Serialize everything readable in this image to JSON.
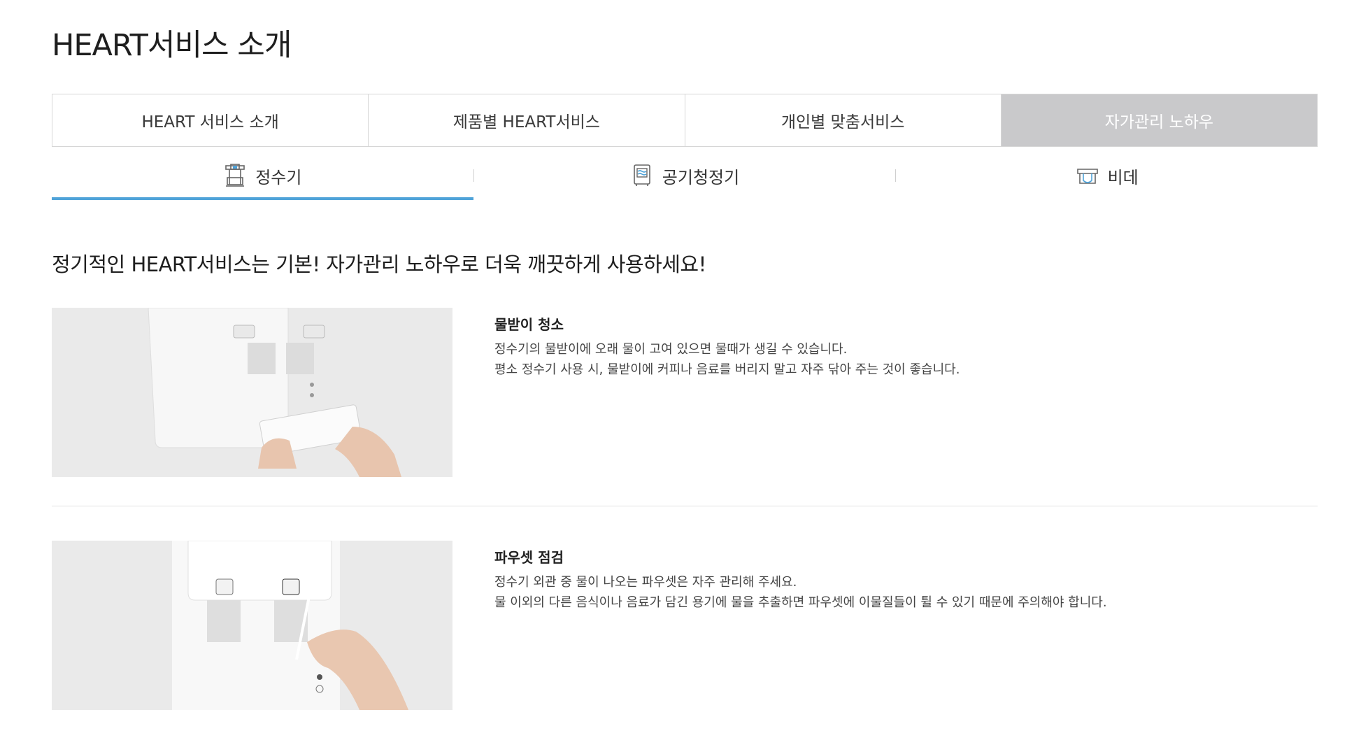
{
  "page": {
    "title": "HEART서비스 소개"
  },
  "main_tabs": [
    {
      "label": "HEART 서비스 소개",
      "active": false
    },
    {
      "label": "제품별 HEART서비스",
      "active": false
    },
    {
      "label": "개인별 맞춤서비스",
      "active": false
    },
    {
      "label": "자가관리 노하우",
      "active": true
    }
  ],
  "sub_tabs": [
    {
      "label": "정수기",
      "icon": "water-purifier-icon",
      "active": true
    },
    {
      "label": "공기청정기",
      "icon": "air-purifier-icon",
      "active": false
    },
    {
      "label": "비데",
      "icon": "bidet-icon",
      "active": false
    }
  ],
  "intro": "정기적인 HEART서비스는 기본! 자가관리 노하우로 더욱 깨끗하게 사용하세요!",
  "tips": [
    {
      "title": "물받이 청소",
      "lines": [
        "정수기의 물받이에 오래 물이 고여 있으면 물때가 생길 수 있습니다.",
        "평소 정수기 사용 시, 물받이에 커피나 음료를 버리지 말고 자주 닦아 주는 것이 좋습니다."
      ]
    },
    {
      "title": "파우셋 점검",
      "lines": [
        "정수기 외관 중 물이 나오는 파우셋은 자주 관리해 주세요.",
        "물 이외의 다른 음식이나 음료가 담긴 용기에 물을 추출하면 파우셋에 이물질들이 튈 수 있기 때문에 주의해야 합니다."
      ]
    }
  ],
  "colors": {
    "active_tab_bg": "#c9c9cb",
    "sub_tab_underline": "#4fa3d9",
    "border": "#d6d6d6"
  }
}
